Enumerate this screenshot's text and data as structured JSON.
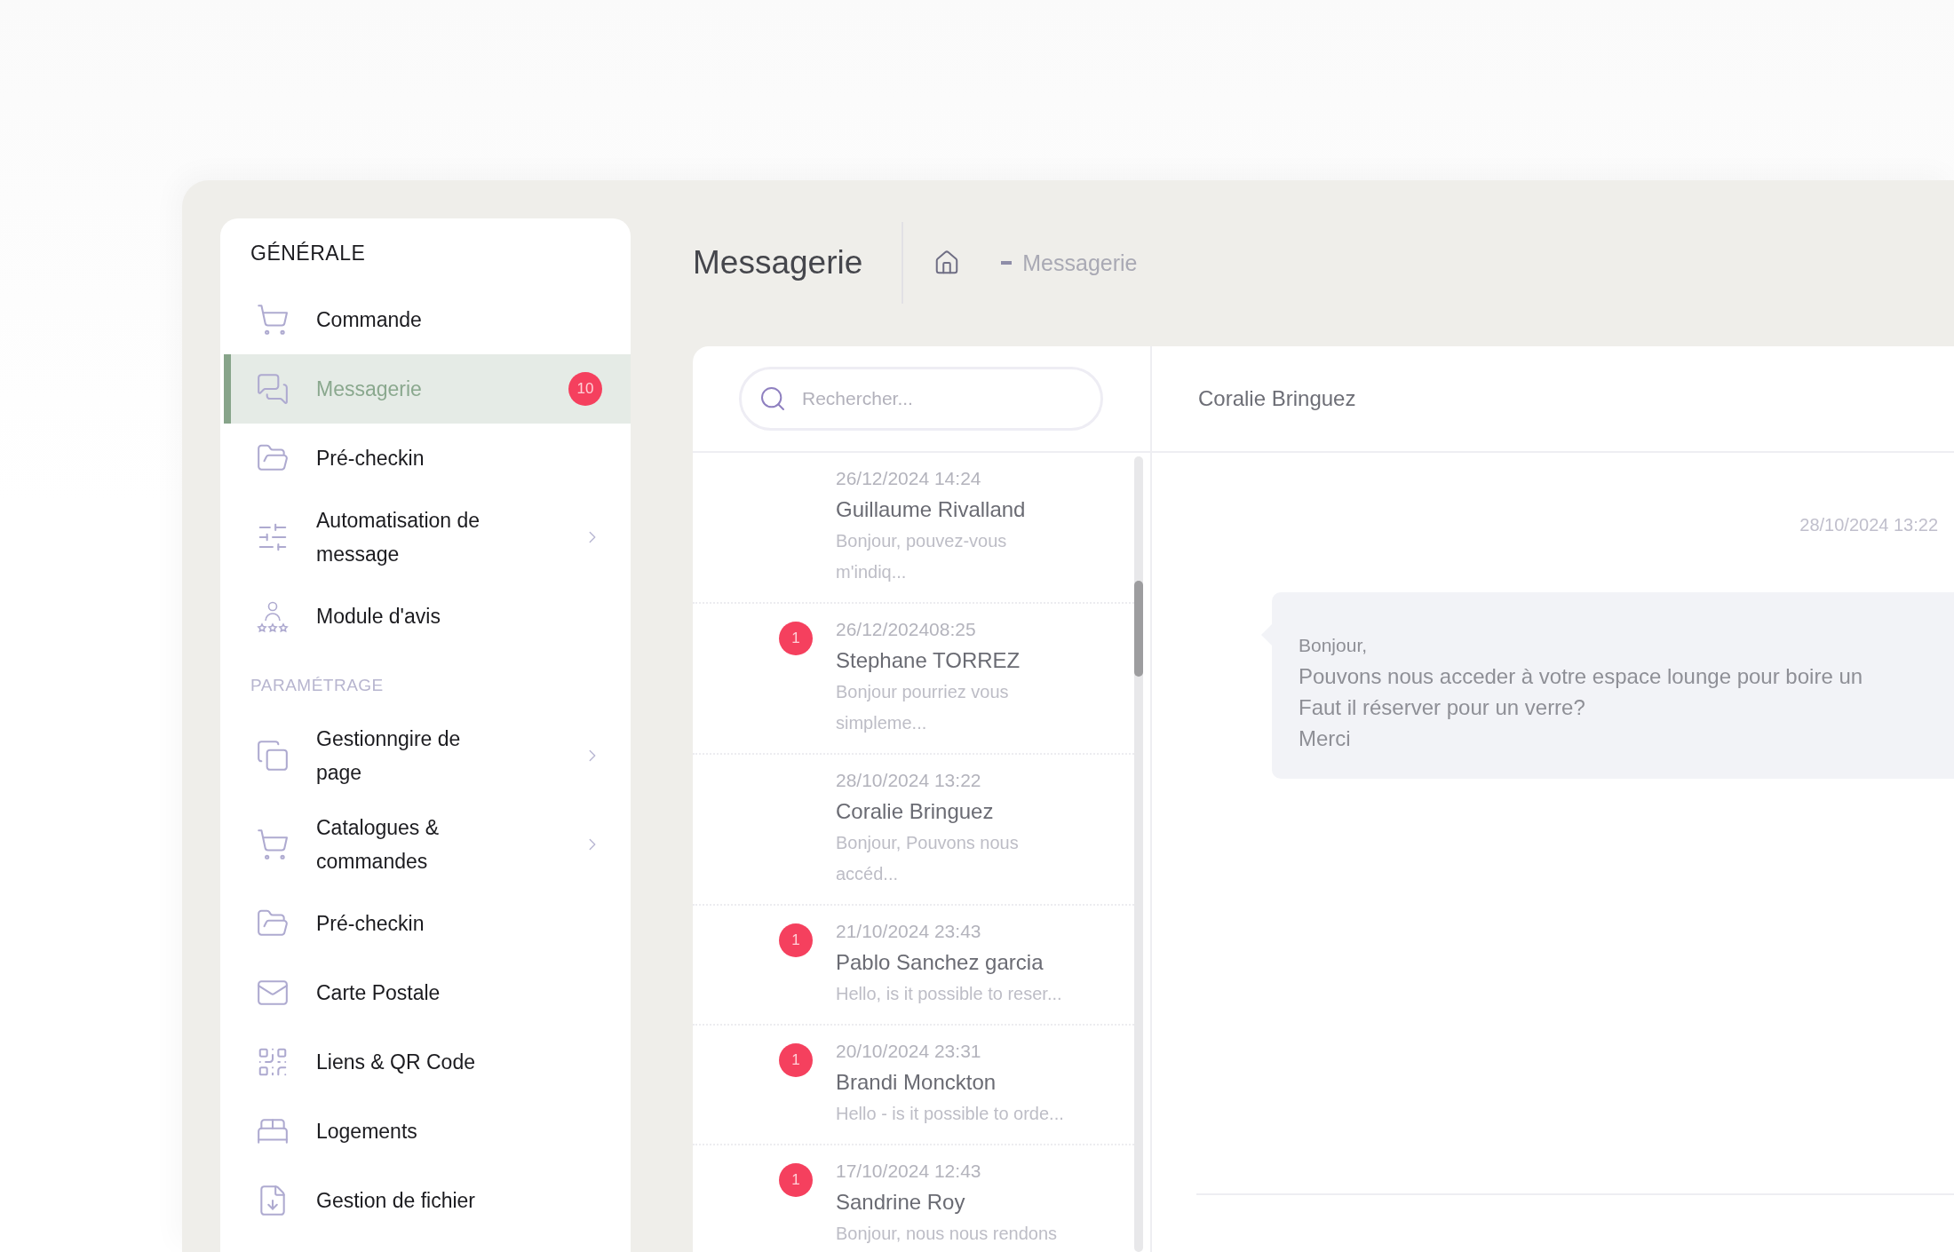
{
  "sidebar": {
    "sections": [
      {
        "title": "GÉNÉRALE",
        "kind": "primary",
        "items": [
          {
            "label": "Commande",
            "selected": false,
            "expandable": false
          },
          {
            "label": "Messagerie",
            "selected": true,
            "expandable": false,
            "badge": "10"
          },
          {
            "label": "Pré-checkin",
            "selected": false,
            "expandable": false
          },
          {
            "label": "Automatisation de message",
            "selected": false,
            "expandable": true
          },
          {
            "label": "Module d'avis",
            "selected": false,
            "expandable": false
          }
        ]
      },
      {
        "title": "PARAMÉTRAGE",
        "kind": "muted",
        "items": [
          {
            "label": "Gestionngire de page",
            "selected": false,
            "expandable": true
          },
          {
            "label": "Catalogues & commandes",
            "selected": false,
            "expandable": true
          },
          {
            "label": "Pré-checkin",
            "selected": false,
            "expandable": false
          },
          {
            "label": "Carte Postale",
            "selected": false,
            "expandable": false
          },
          {
            "label": "Liens & QR Code",
            "selected": false,
            "expandable": false
          },
          {
            "label": "Logements",
            "selected": false,
            "expandable": false
          },
          {
            "label": "Gestion de fichier",
            "selected": false,
            "expandable": false
          }
        ]
      }
    ]
  },
  "header": {
    "title": "Messagerie",
    "breadcrumb": "Messagerie"
  },
  "search": {
    "placeholder": "Rechercher..."
  },
  "conversations": [
    {
      "date": "26/12/2024 14:24",
      "name": "Guillaume Rivalland",
      "preview": "Bonjour, pouvez-vous m'indiq..."
    },
    {
      "date": "26/12/202408:25",
      "name": "Stephane TORREZ",
      "preview": "Bonjour pourriez vous simpleme...",
      "unread": "1"
    },
    {
      "date": "28/10/2024 13:22",
      "name": "Coralie Bringuez",
      "preview": "Bonjour, Pouvons nous accéd..."
    },
    {
      "date": "21/10/2024 23:43",
      "name": "Pablo Sanchez garcia",
      "preview": "Hello, is it possible to reser...",
      "unread": "1"
    },
    {
      "date": "20/10/2024 23:31",
      "name": "Brandi Monckton",
      "preview": "Hello - is it possible to orde...",
      "unread": "1"
    },
    {
      "date": "17/10/2024 12:43",
      "name": "Sandrine Roy",
      "preview": "Bonjour, nous nous rendons",
      "unread": "1"
    }
  ],
  "chat": {
    "contact": "Coralie Bringuez",
    "messages": [
      {
        "time": "28/10/2024 13:22",
        "lines": [
          "Bonjour,",
          "Pouvons nous acceder à votre espace lounge pour boire un",
          "Faut il réserver pour un verre?",
          "Merci"
        ]
      }
    ]
  }
}
